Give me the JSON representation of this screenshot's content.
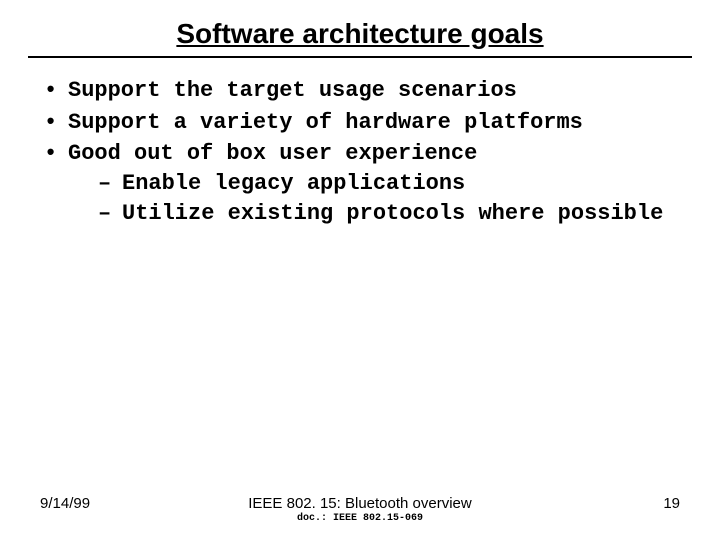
{
  "title": "Software architecture goals",
  "bullets": {
    "b1": "Support the target usage scenarios",
    "b2": "Support a variety of hardware platforms",
    "b3": "Good out of box user experience",
    "b3_sub1": "Enable legacy applications",
    "b3_sub2": "Utilize existing protocols where possible"
  },
  "footer": {
    "date": "9/14/99",
    "center": "IEEE 802. 15: Bluetooth overview",
    "doc": "doc.: IEEE 802.15-069",
    "page": "19"
  }
}
